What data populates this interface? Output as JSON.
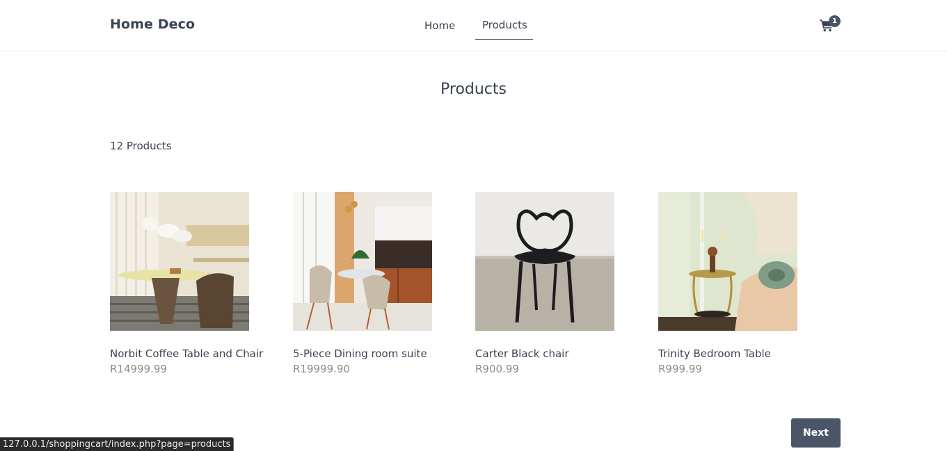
{
  "header": {
    "brand": "Home Deco",
    "nav": [
      {
        "label": "Home"
      },
      {
        "label": "Products",
        "active": true
      }
    ],
    "cart": {
      "icon": "shopping-cart-icon",
      "count": "1"
    }
  },
  "main": {
    "title": "Products",
    "count_label": "12 Products",
    "products": [
      {
        "name": "Norbit Coffee Table and Chair",
        "price": "R14999.99"
      },
      {
        "name": "5-Piece Dining room suite",
        "price": "R19999.90"
      },
      {
        "name": "Carter Black chair",
        "price": "R900.99"
      },
      {
        "name": "Trinity Bedroom Table",
        "price": "R999.99"
      }
    ],
    "next_label": "Next"
  },
  "status_bar": {
    "url": "127.0.0.1/shoppingcart/index.php?page=products"
  },
  "colors": {
    "text": "#394352",
    "accent": "#4a5568",
    "price": "#8c8c8c"
  }
}
